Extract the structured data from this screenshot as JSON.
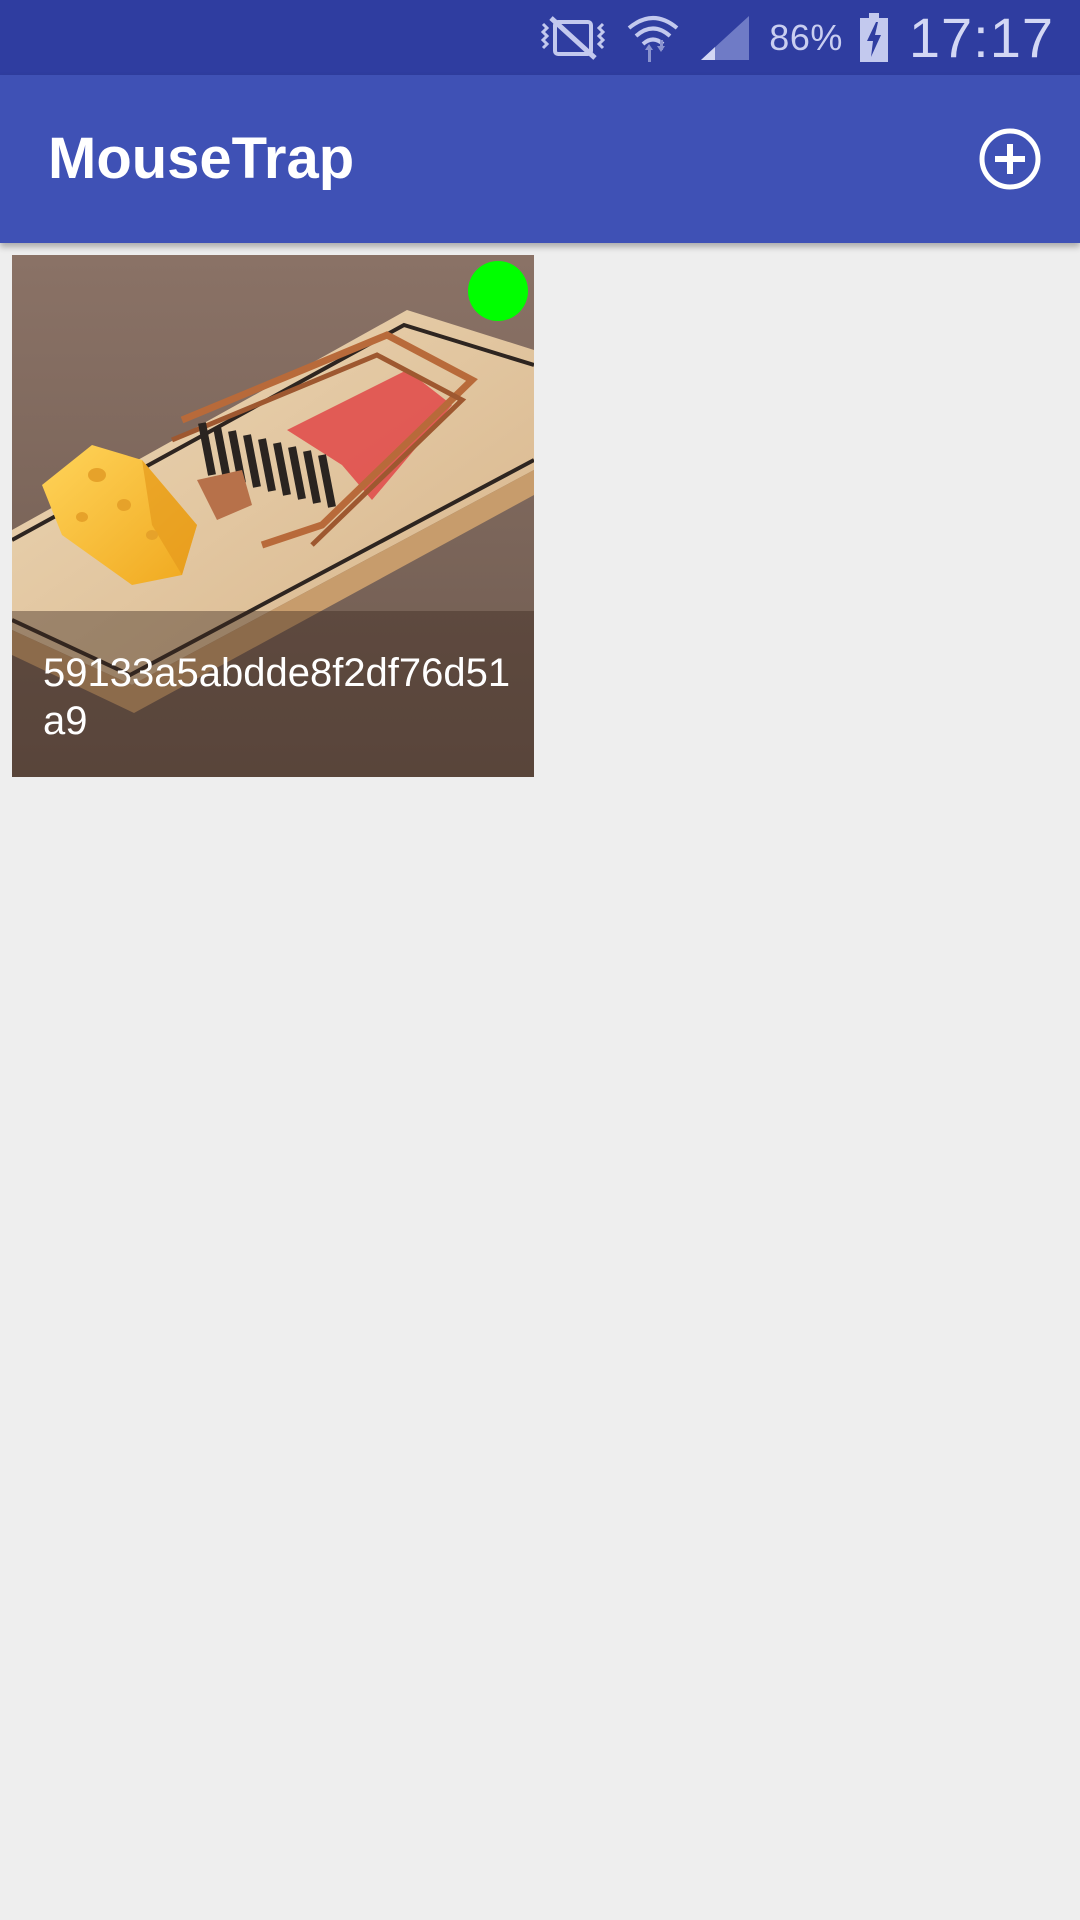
{
  "status_bar": {
    "battery_percent": "86%",
    "time": "17:17",
    "icons": [
      "vibrate-mute-icon",
      "wifi-icon",
      "signal-icon",
      "battery-charging-icon"
    ]
  },
  "app_bar": {
    "title": "MouseTrap",
    "add_icon": "add-circle-icon"
  },
  "traps": [
    {
      "id": "59133a5abdde8f2df76d51a9",
      "image": "mousetrap-with-cheese",
      "status_color": "#00ff00"
    }
  ],
  "colors": {
    "status_bar": "#2f3da0",
    "app_bar": "#3f51b5",
    "background": "#eeeeee",
    "status_active": "#00ff00"
  }
}
